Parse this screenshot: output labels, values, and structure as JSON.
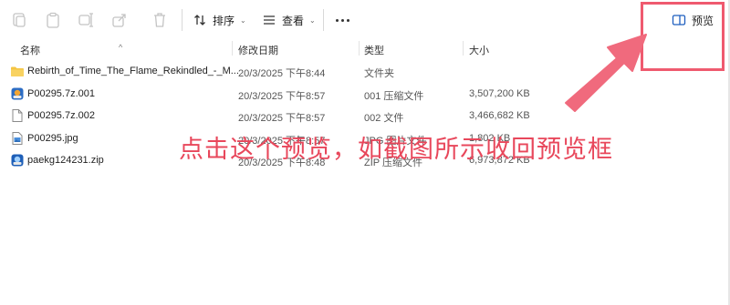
{
  "toolbar": {
    "sort_label": "排序",
    "view_label": "查看",
    "preview_label": "预览",
    "icons": [
      "copy-icon",
      "paste-icon",
      "rename-icon",
      "share-icon",
      "delete-icon",
      "sort-icon",
      "view-icon",
      "more-icon",
      "preview-pane-icon"
    ]
  },
  "columns": {
    "name": "名称",
    "date": "修改日期",
    "type": "类型",
    "size": "大小"
  },
  "files": [
    {
      "name": "Rebirth_of_Time_The_Flame_Rekindled_-_M...",
      "date": "20/3/2025 下午8:44",
      "type": "文件夹",
      "size": "",
      "icon": "folder-icon"
    },
    {
      "name": "P00295.7z.001",
      "date": "20/3/2025 下午8:57",
      "type": "001 压缩文件",
      "size": "3,507,200 KB",
      "icon": "archive-icon"
    },
    {
      "name": "P00295.7z.002",
      "date": "20/3/2025 下午8:57",
      "type": "002 文件",
      "size": "3,466,682 KB",
      "icon": "file-icon"
    },
    {
      "name": "P00295.jpg",
      "date": "20/3/2025 下午8:57",
      "type": "JPG 图片文件",
      "size": "1,802 KB",
      "icon": "image-file-icon"
    },
    {
      "name": "paekg124231.zip",
      "date": "20/3/2025 下午8:48",
      "type": "ZIP 压缩文件",
      "size": "6,973,872 KB",
      "icon": "zip-icon"
    }
  ],
  "annotation": {
    "text": "点击这个预览，如截图所示收回预览框",
    "color": "#e8475b"
  }
}
